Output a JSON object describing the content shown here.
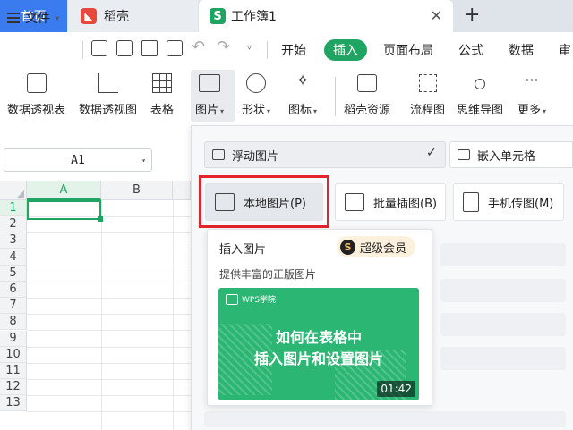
{
  "tabs": {
    "home": "首页",
    "daoke": "稻壳",
    "workbook": "工作簿1",
    "workbook_logo": "S"
  },
  "menu": {
    "file": "文件",
    "tabs": [
      "开始",
      "插入",
      "页面布局",
      "公式",
      "数据",
      "审"
    ],
    "active": "插入"
  },
  "ribbon": {
    "items": [
      "数据透视表",
      "数据透视图",
      "表格",
      "图片",
      "形状",
      "图标",
      "稻壳资源",
      "流程图",
      "思维导图",
      "更多"
    ]
  },
  "namebox": {
    "value": "A1"
  },
  "sheet": {
    "columns": [
      "A",
      "B"
    ],
    "rows": [
      "1",
      "2",
      "3",
      "4",
      "5",
      "6",
      "7",
      "8",
      "9",
      "10",
      "11",
      "12",
      "13"
    ]
  },
  "picture_panel": {
    "mode_float": "浮动图片",
    "mode_embed": "嵌入单元格",
    "btn_local": "本地图片(P)",
    "btn_batch": "批量插图(B)",
    "btn_phone": "手机传图(M)"
  },
  "tooltip": {
    "title": "插入图片",
    "vip_label": "超级会员",
    "vip_icon": "S",
    "desc": "提供丰富的正版图片",
    "video_brand": "WPS学院",
    "video_line1": "如何在表格中",
    "video_line2": "插入图片和设置图片",
    "video_time": "01:42"
  },
  "colors": {
    "brand_green": "#1fa463",
    "home_blue": "#3a7bf0",
    "highlight_red": "#e4232b"
  }
}
